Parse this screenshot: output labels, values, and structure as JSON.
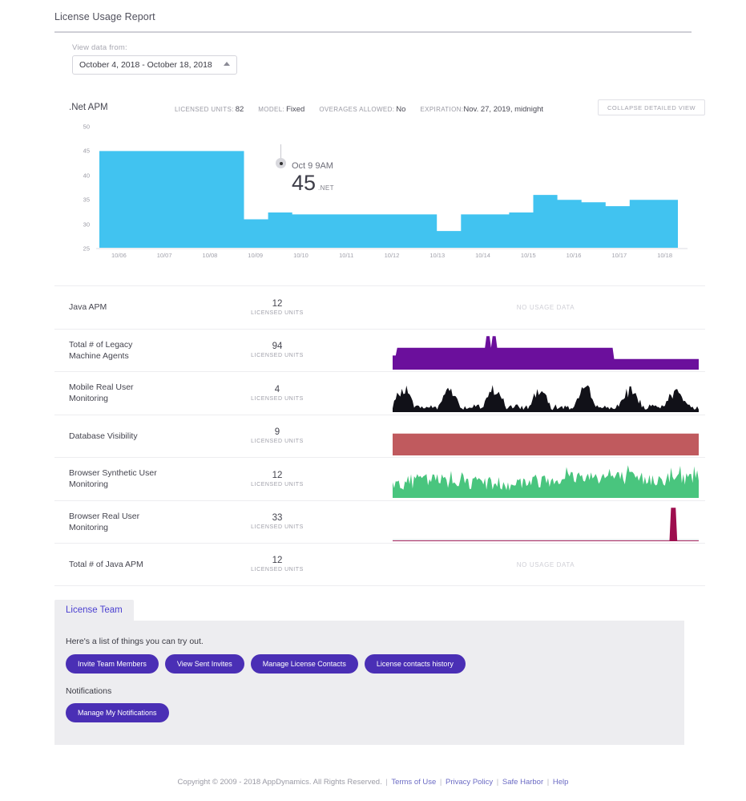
{
  "header": {
    "title": "License Usage Report"
  },
  "date_range": {
    "label": "View data from:",
    "value": "October 4, 2018 - October 18, 2018"
  },
  "detail_chart": {
    "name": ".Net APM",
    "meta": [
      {
        "key": "LICENSED UNITS:",
        "value": "82"
      },
      {
        "key": "MODEL:",
        "value": "Fixed"
      },
      {
        "key": "OVERAGES ALLOWED:",
        "value": "No"
      },
      {
        "key": "EXPIRATION:",
        "value": "Nov. 27, 2019, midnight"
      }
    ],
    "collapse_label": "COLLAPSE DETAILED VIEW",
    "tooltip": {
      "date": "Oct 9 9AM",
      "value": "45",
      "unit": ".NET"
    },
    "color": "#41c3f0"
  },
  "chart_data": {
    "type": "area",
    "title": ".Net APM",
    "xlabel": "",
    "ylabel": "",
    "ylim": [
      25,
      50
    ],
    "yticks": [
      50,
      45,
      40,
      35,
      30,
      25
    ],
    "xticks": [
      "10/06",
      "10/07",
      "10/08",
      "10/09",
      "10/10",
      "10/11",
      "10/12",
      "10/13",
      "10/14",
      "10/15",
      "10/16",
      "10/17",
      "10/18"
    ],
    "grid": false,
    "legend": "none",
    "color": "#41c3f0",
    "annotation": {
      "x": "Oct 9 9AM",
      "y": 45,
      "label": "45 .NET"
    },
    "series": [
      {
        "name": ".Net APM",
        "x": [
          "10/04",
          "10/05",
          "10/06",
          "10/07",
          "10/08",
          "10/09 9AM",
          "10/09 11AM",
          "10/09 12PM",
          "10/09 6PM",
          "10/10",
          "10/11",
          "10/12",
          "10/13",
          "10/13 18:00",
          "10/13 19:00",
          "10/14",
          "10/15 00:00",
          "10/15 06:00",
          "10/15 09:00",
          "10/15 18:00",
          "10/16 00:00",
          "10/16 06:00",
          "10/16 12:00",
          "10/17",
          "10/18"
        ],
        "values": [
          45,
          45,
          45,
          45,
          45,
          45,
          31,
          32.4,
          32,
          32,
          32,
          32,
          32,
          32,
          28.6,
          32,
          32,
          32.4,
          36,
          35,
          34.5,
          33.7,
          35,
          35,
          35
        ]
      }
    ]
  },
  "license_rows": [
    {
      "name": "Java APM",
      "units": "12",
      "units_caption": "LICENSED UNITS",
      "has_data": false,
      "no_data_label": "NO USAGE DATA",
      "spark_type": "none",
      "color": ""
    },
    {
      "name": "Total # of Legacy\nMachine Agents",
      "units": "94",
      "units_caption": "LICENSED UNITS",
      "has_data": true,
      "no_data_label": "",
      "spark_type": "block",
      "color": "#6b0f9c"
    },
    {
      "name": "Mobile Real User\nMonitoring",
      "units": "4",
      "units_caption": "LICENSED UNITS",
      "has_data": true,
      "no_data_label": "",
      "spark_type": "spiky",
      "color": "#111118"
    },
    {
      "name": "Database Visibility",
      "units": "9",
      "units_caption": "LICENSED UNITS",
      "has_data": true,
      "no_data_label": "",
      "spark_type": "flat",
      "color": "#c05a5e"
    },
    {
      "name": "Browser Synthetic User\nMonitoring",
      "units": "12",
      "units_caption": "LICENSED UNITS",
      "has_data": true,
      "no_data_label": "",
      "spark_type": "noisy",
      "color": "#49c57e"
    },
    {
      "name": "Browser Real User\nMonitoring",
      "units": "33",
      "units_caption": "LICENSED UNITS",
      "has_data": true,
      "no_data_label": "",
      "spark_type": "single-spike",
      "color": "#9e0e4e"
    },
    {
      "name": "Total # of Java APM",
      "units": "12",
      "units_caption": "LICENSED UNITS",
      "has_data": false,
      "no_data_label": "NO USAGE DATA",
      "spark_type": "none",
      "color": ""
    }
  ],
  "tab_panel": {
    "tab_label": "License Team",
    "intro": "Here's a list of things you can try out.",
    "buttons": [
      "Invite Team Members",
      "View Sent Invites",
      "Manage License Contacts",
      "License contacts history"
    ],
    "notifications_label": "Notifications",
    "notifications_button": "Manage My Notifications"
  },
  "footer": {
    "copyright": "Copyright © 2009 - 2018 AppDynamics. All Rights Reserved.",
    "links": [
      "Terms of Use",
      "Privacy Policy",
      "Safe Harbor",
      "Help"
    ]
  }
}
